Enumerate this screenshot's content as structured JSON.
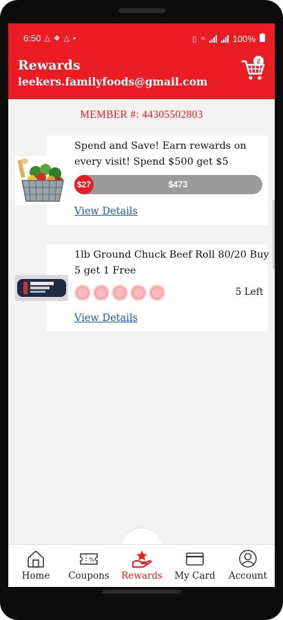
{
  "status_bar": {
    "time": "6:50",
    "left_icons": [
      "notification-a-icon",
      "notification-b-icon",
      "notification-c-icon",
      "dot-icon"
    ],
    "right_icons": [
      "vibrate-icon",
      "wifi-icon",
      "signal-icon",
      "signal-icon",
      "battery-icon"
    ],
    "battery": "100%"
  },
  "app_bar": {
    "title": "Rewards",
    "email": "leekers.familyfoods@gmail.com",
    "cart_count": "2"
  },
  "member": {
    "text": "MEMBER #: 44305502803"
  },
  "offers": [
    {
      "title": "Spend and Save! Earn rewards on every visit! Spend $500 get $5",
      "image": "grocery-basket-image",
      "progress_earned": "$27",
      "progress_remaining": "$473",
      "progress_fraction": 0.054,
      "link": "View Details"
    },
    {
      "title": "1lb Ground Chuck Beef Roll 80/20 Buy 5 get 1 Free",
      "image": "ground-chuck-package-image",
      "punches_total": 5,
      "punches_filled": 0,
      "remaining_label": "5 Left",
      "link": "View Details"
    }
  ],
  "tabs": [
    {
      "label": "Home",
      "icon": "home-icon"
    },
    {
      "label": "Coupons",
      "icon": "coupon-icon"
    },
    {
      "label": "Rewards",
      "icon": "rewards-icon",
      "active": true
    },
    {
      "label": "My Card",
      "icon": "card-icon"
    },
    {
      "label": "Account",
      "icon": "account-icon"
    }
  ],
  "colors": {
    "brand_red": "#ec1c24",
    "link_blue": "#1a56b8",
    "progress_gray": "#9b9b9b",
    "punch_pink": "#f9b9bd"
  }
}
